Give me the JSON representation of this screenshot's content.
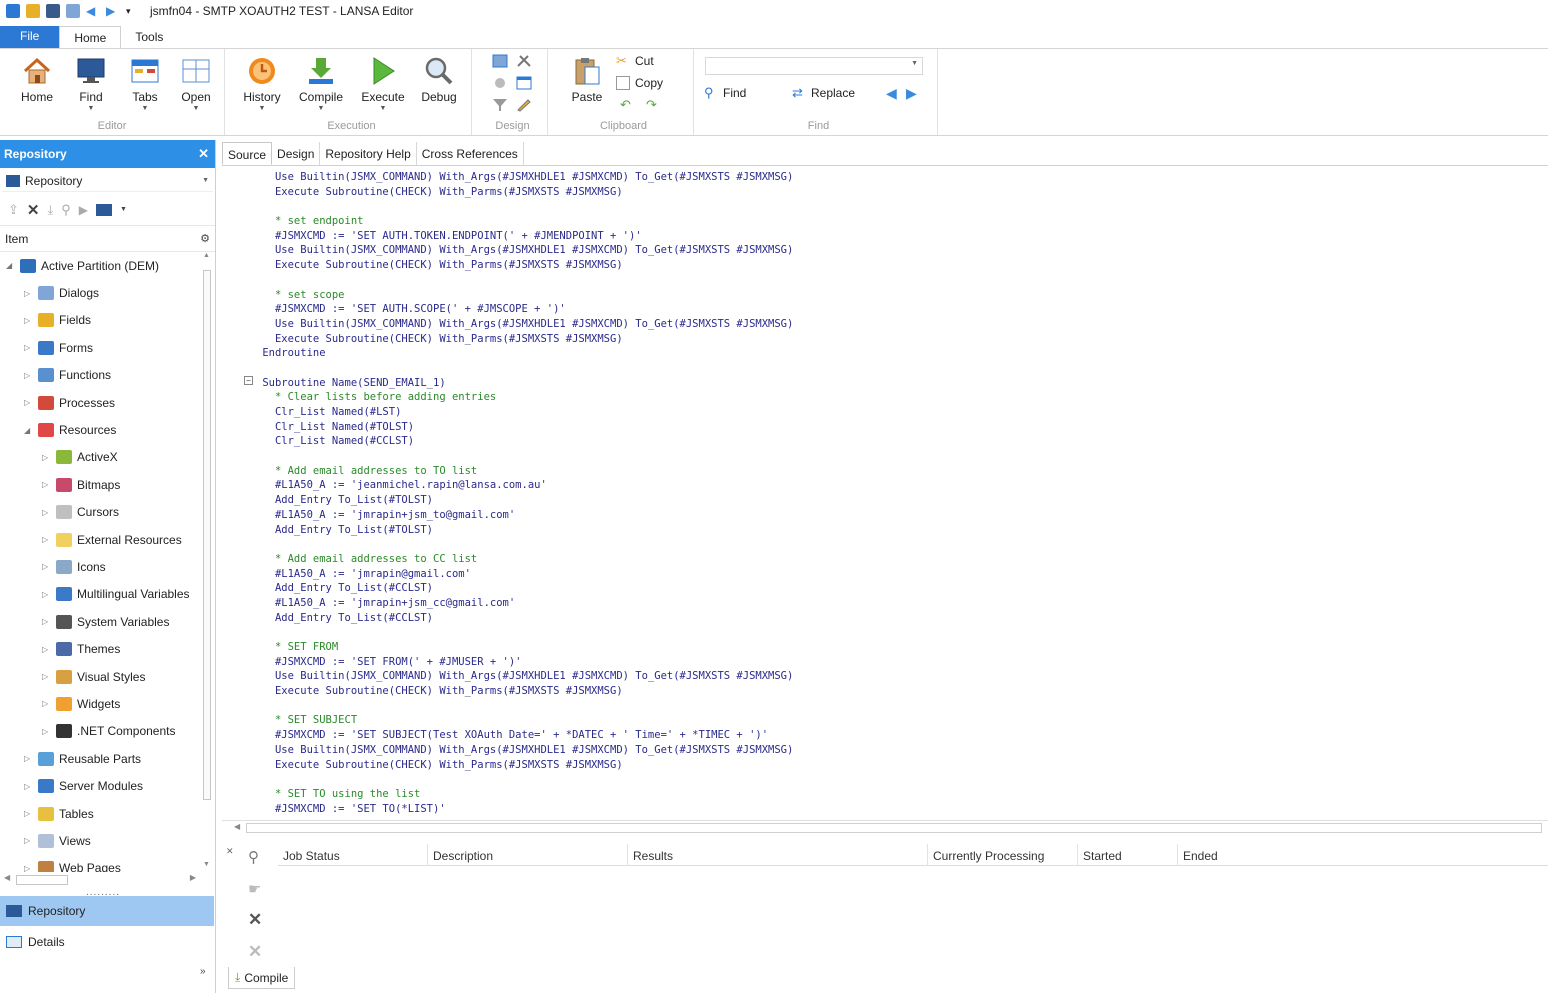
{
  "window": {
    "title": "jsmfn04 - SMTP XOAUTH2 TEST - LANSA Editor"
  },
  "ribbon_tabs": [
    "File",
    "Home",
    "Tools"
  ],
  "ribbon": {
    "editor": {
      "label": "Editor",
      "home": "Home",
      "find": "Find",
      "tabs": "Tabs",
      "open": "Open"
    },
    "execution": {
      "label": "Execution",
      "history": "History",
      "compile": "Compile",
      "execute": "Execute",
      "debug": "Debug"
    },
    "design": {
      "label": "Design"
    },
    "clipboard": {
      "label": "Clipboard",
      "paste": "Paste",
      "cut": "Cut",
      "copy": "Copy"
    },
    "find": {
      "label": "Find",
      "find": "Find",
      "replace": "Replace",
      "search_value": ""
    }
  },
  "repository": {
    "header": "Repository",
    "selector": "Repository",
    "column": "Item",
    "tree": [
      {
        "label": "Active Partition (DEM)",
        "level": 0,
        "expanded": true,
        "color": "#2d6fb8"
      },
      {
        "label": "Dialogs",
        "level": 1,
        "color": "#7fa6d6"
      },
      {
        "label": "Fields",
        "level": 1,
        "color": "#e8b028"
      },
      {
        "label": "Forms",
        "level": 1,
        "color": "#3a78c8"
      },
      {
        "label": "Functions",
        "level": 1,
        "color": "#5a8fd0"
      },
      {
        "label": "Processes",
        "level": 1,
        "color": "#d24a3a"
      },
      {
        "label": "Resources",
        "level": 1,
        "expanded": true,
        "color": "#e04848"
      },
      {
        "label": "ActiveX",
        "level": 2,
        "color": "#8ab83a"
      },
      {
        "label": "Bitmaps",
        "level": 2,
        "color": "#c84a6a"
      },
      {
        "label": "Cursors",
        "level": 2,
        "color": "#bfbfbf"
      },
      {
        "label": "External Resources",
        "level": 2,
        "color": "#f0d060"
      },
      {
        "label": "Icons",
        "level": 2,
        "color": "#8aa8c8"
      },
      {
        "label": "Multilingual Variables",
        "level": 2,
        "color": "#3a78c8"
      },
      {
        "label": "System Variables",
        "level": 2,
        "color": "#555555"
      },
      {
        "label": "Themes",
        "level": 2,
        "color": "#4a6aa8"
      },
      {
        "label": "Visual Styles",
        "level": 2,
        "color": "#d8a040"
      },
      {
        "label": "Widgets",
        "level": 2,
        "color": "#f0a030"
      },
      {
        "label": ".NET Components",
        "level": 2,
        "color": "#333333"
      },
      {
        "label": "Reusable Parts",
        "level": 1,
        "color": "#58a0d8"
      },
      {
        "label": "Server Modules",
        "level": 1,
        "color": "#3a78c8"
      },
      {
        "label": "Tables",
        "level": 1,
        "color": "#e8c040"
      },
      {
        "label": "Views",
        "level": 1,
        "color": "#b0c0d8"
      },
      {
        "label": "Web Pages",
        "level": 1,
        "color": "#c08040"
      }
    ],
    "nav": [
      "Repository",
      "Details"
    ]
  },
  "editor_tabs": [
    "Source",
    "Design",
    "Repository Help",
    "Cross References"
  ],
  "code_lines": [
    {
      "text": "   Use Builtin(JSMX_COMMAND) With_Args(#JSMXHDLE1 #JSMXCMD) To_Get(#JSMXSTS #JSMXMSG)"
    },
    {
      "text": "   Execute Subroutine(CHECK) With_Parms(#JSMXSTS #JSMXMSG)"
    },
    {
      "text": ""
    },
    {
      "text": "   * set endpoint",
      "comment": true
    },
    {
      "text": "   #JSMXCMD := 'SET AUTH.TOKEN.ENDPOINT(' + #JMENDPOINT + ')'"
    },
    {
      "text": "   Use Builtin(JSMX_COMMAND) With_Args(#JSMXHDLE1 #JSMXCMD) To_Get(#JSMXSTS #JSMXMSG)"
    },
    {
      "text": "   Execute Subroutine(CHECK) With_Parms(#JSMXSTS #JSMXMSG)"
    },
    {
      "text": ""
    },
    {
      "text": "   * set scope",
      "comment": true
    },
    {
      "text": "   #JSMXCMD := 'SET AUTH.SCOPE(' + #JMSCOPE + ')'"
    },
    {
      "text": "   Use Builtin(JSMX_COMMAND) With_Args(#JSMXHDLE1 #JSMXCMD) To_Get(#JSMXSTS #JSMXMSG)"
    },
    {
      "text": "   Execute Subroutine(CHECK) With_Parms(#JSMXSTS #JSMXMSG)"
    },
    {
      "text": " Endroutine"
    },
    {
      "text": ""
    },
    {
      "text": " Subroutine Name(SEND_EMAIL_1)"
    },
    {
      "text": "   * Clear lists before adding entries",
      "comment": true
    },
    {
      "text": "   Clr_List Named(#LST)"
    },
    {
      "text": "   Clr_List Named(#TOLST)"
    },
    {
      "text": "   Clr_List Named(#CCLST)"
    },
    {
      "text": ""
    },
    {
      "text": "   * Add email addresses to TO list",
      "comment": true
    },
    {
      "text": "   #L1A50_A := 'jeanmichel.rapin@lansa.com.au'"
    },
    {
      "text": "   Add_Entry To_List(#TOLST)"
    },
    {
      "text": "   #L1A50_A := 'jmrapin+jsm_to@gmail.com'"
    },
    {
      "text": "   Add_Entry To_List(#TOLST)"
    },
    {
      "text": ""
    },
    {
      "text": "   * Add email addresses to CC list",
      "comment": true
    },
    {
      "text": "   #L1A50_A := 'jmrapin@gmail.com'"
    },
    {
      "text": "   Add_Entry To_List(#CCLST)"
    },
    {
      "text": "   #L1A50_A := 'jmrapin+jsm_cc@gmail.com'"
    },
    {
      "text": "   Add_Entry To_List(#CCLST)"
    },
    {
      "text": ""
    },
    {
      "text": "   * SET FROM",
      "comment": true
    },
    {
      "text": "   #JSMXCMD := 'SET FROM(' + #JMUSER + ')'"
    },
    {
      "text": "   Use Builtin(JSMX_COMMAND) With_Args(#JSMXHDLE1 #JSMXCMD) To_Get(#JSMXSTS #JSMXMSG)"
    },
    {
      "text": "   Execute Subroutine(CHECK) With_Parms(#JSMXSTS #JSMXMSG)"
    },
    {
      "text": ""
    },
    {
      "text": "   * SET SUBJECT",
      "comment": true
    },
    {
      "text": "   #JSMXCMD := 'SET SUBJECT(Test XOAuth Date=' + *DATEC + ' Time=' + *TIMEC + ')'"
    },
    {
      "text": "   Use Builtin(JSMX_COMMAND) With_Args(#JSMXHDLE1 #JSMXCMD) To_Get(#JSMXSTS #JSMXMSG)"
    },
    {
      "text": "   Execute Subroutine(CHECK) With_Parms(#JSMXSTS #JSMXMSG)"
    },
    {
      "text": ""
    },
    {
      "text": "   * SET TO using the list",
      "comment": true
    },
    {
      "text": "   #JSMXCMD := 'SET TO(*LIST)'"
    }
  ],
  "job_grid": {
    "columns": [
      "Job Status",
      "Description",
      "Results",
      "Currently Processing",
      "Started",
      "Ended"
    ]
  },
  "bottom_tab": "Compile"
}
